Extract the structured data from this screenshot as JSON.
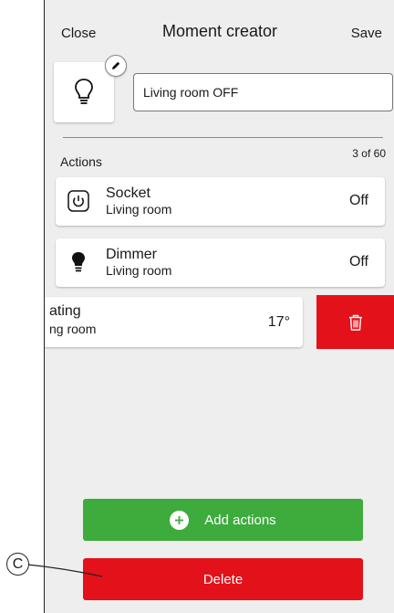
{
  "header": {
    "close_label": "Close",
    "title": "Moment creator",
    "save_label": "Save"
  },
  "moment": {
    "name_value": "Living room OFF",
    "icon": "lightbulb-icon",
    "edit_icon": "pencil-icon"
  },
  "actions": {
    "label": "Actions",
    "count": "3 of 60",
    "items": [
      {
        "name": "Socket",
        "room": "Living room",
        "state": "Off",
        "icon": "power-icon"
      },
      {
        "name": "Dimmer",
        "room": "Living room",
        "state": "Off",
        "icon": "lightbulb-filled-icon"
      }
    ],
    "swiped_item": {
      "name": "ating",
      "room": "ng room",
      "state": "17°",
      "delete_icon": "trash-icon"
    }
  },
  "buttons": {
    "add_actions_label": "Add actions",
    "delete_label": "Delete"
  },
  "annotation": {
    "callout_label": "C"
  },
  "colors": {
    "green": "#3eab3d",
    "red": "#e3111a",
    "background": "#eeeeee"
  }
}
